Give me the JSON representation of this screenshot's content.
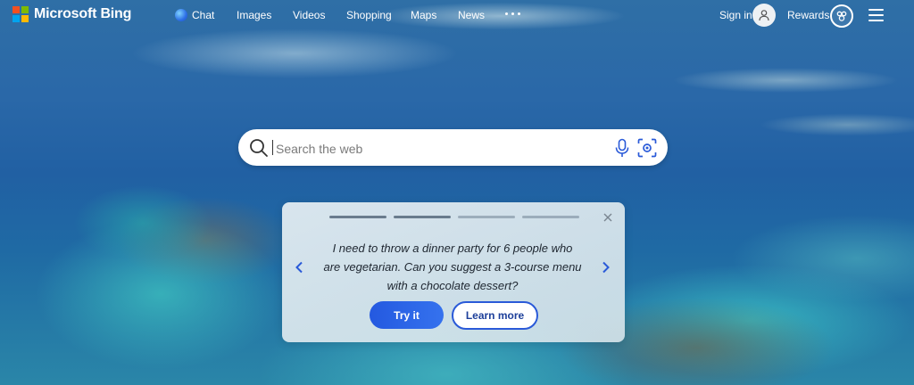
{
  "brand": {
    "name": "Microsoft Bing",
    "logo_colors": [
      "#f25022",
      "#7fba00",
      "#00a4ef",
      "#ffb900"
    ]
  },
  "nav": {
    "items": [
      {
        "label": "Chat",
        "icon": "copilot-icon"
      },
      {
        "label": "Images"
      },
      {
        "label": "Videos"
      },
      {
        "label": "Shopping"
      },
      {
        "label": "Maps"
      },
      {
        "label": "News"
      }
    ],
    "more_icon": "more-dots-icon"
  },
  "account": {
    "signin_label": "Sign in",
    "rewards_label": "Rewards"
  },
  "search": {
    "placeholder": "Search the web",
    "icons": [
      "search-icon",
      "microphone-icon",
      "visual-search-icon"
    ]
  },
  "suggestion_card": {
    "prompt": "I need to throw a dinner party for 6 people who are vegetarian. Can you suggest a 3-course menu with a chocolate dessert?",
    "try_label": "Try it",
    "learn_label": "Learn more",
    "progress_total": 4,
    "progress_current": 2,
    "accent_color": "#2a5ad8"
  }
}
